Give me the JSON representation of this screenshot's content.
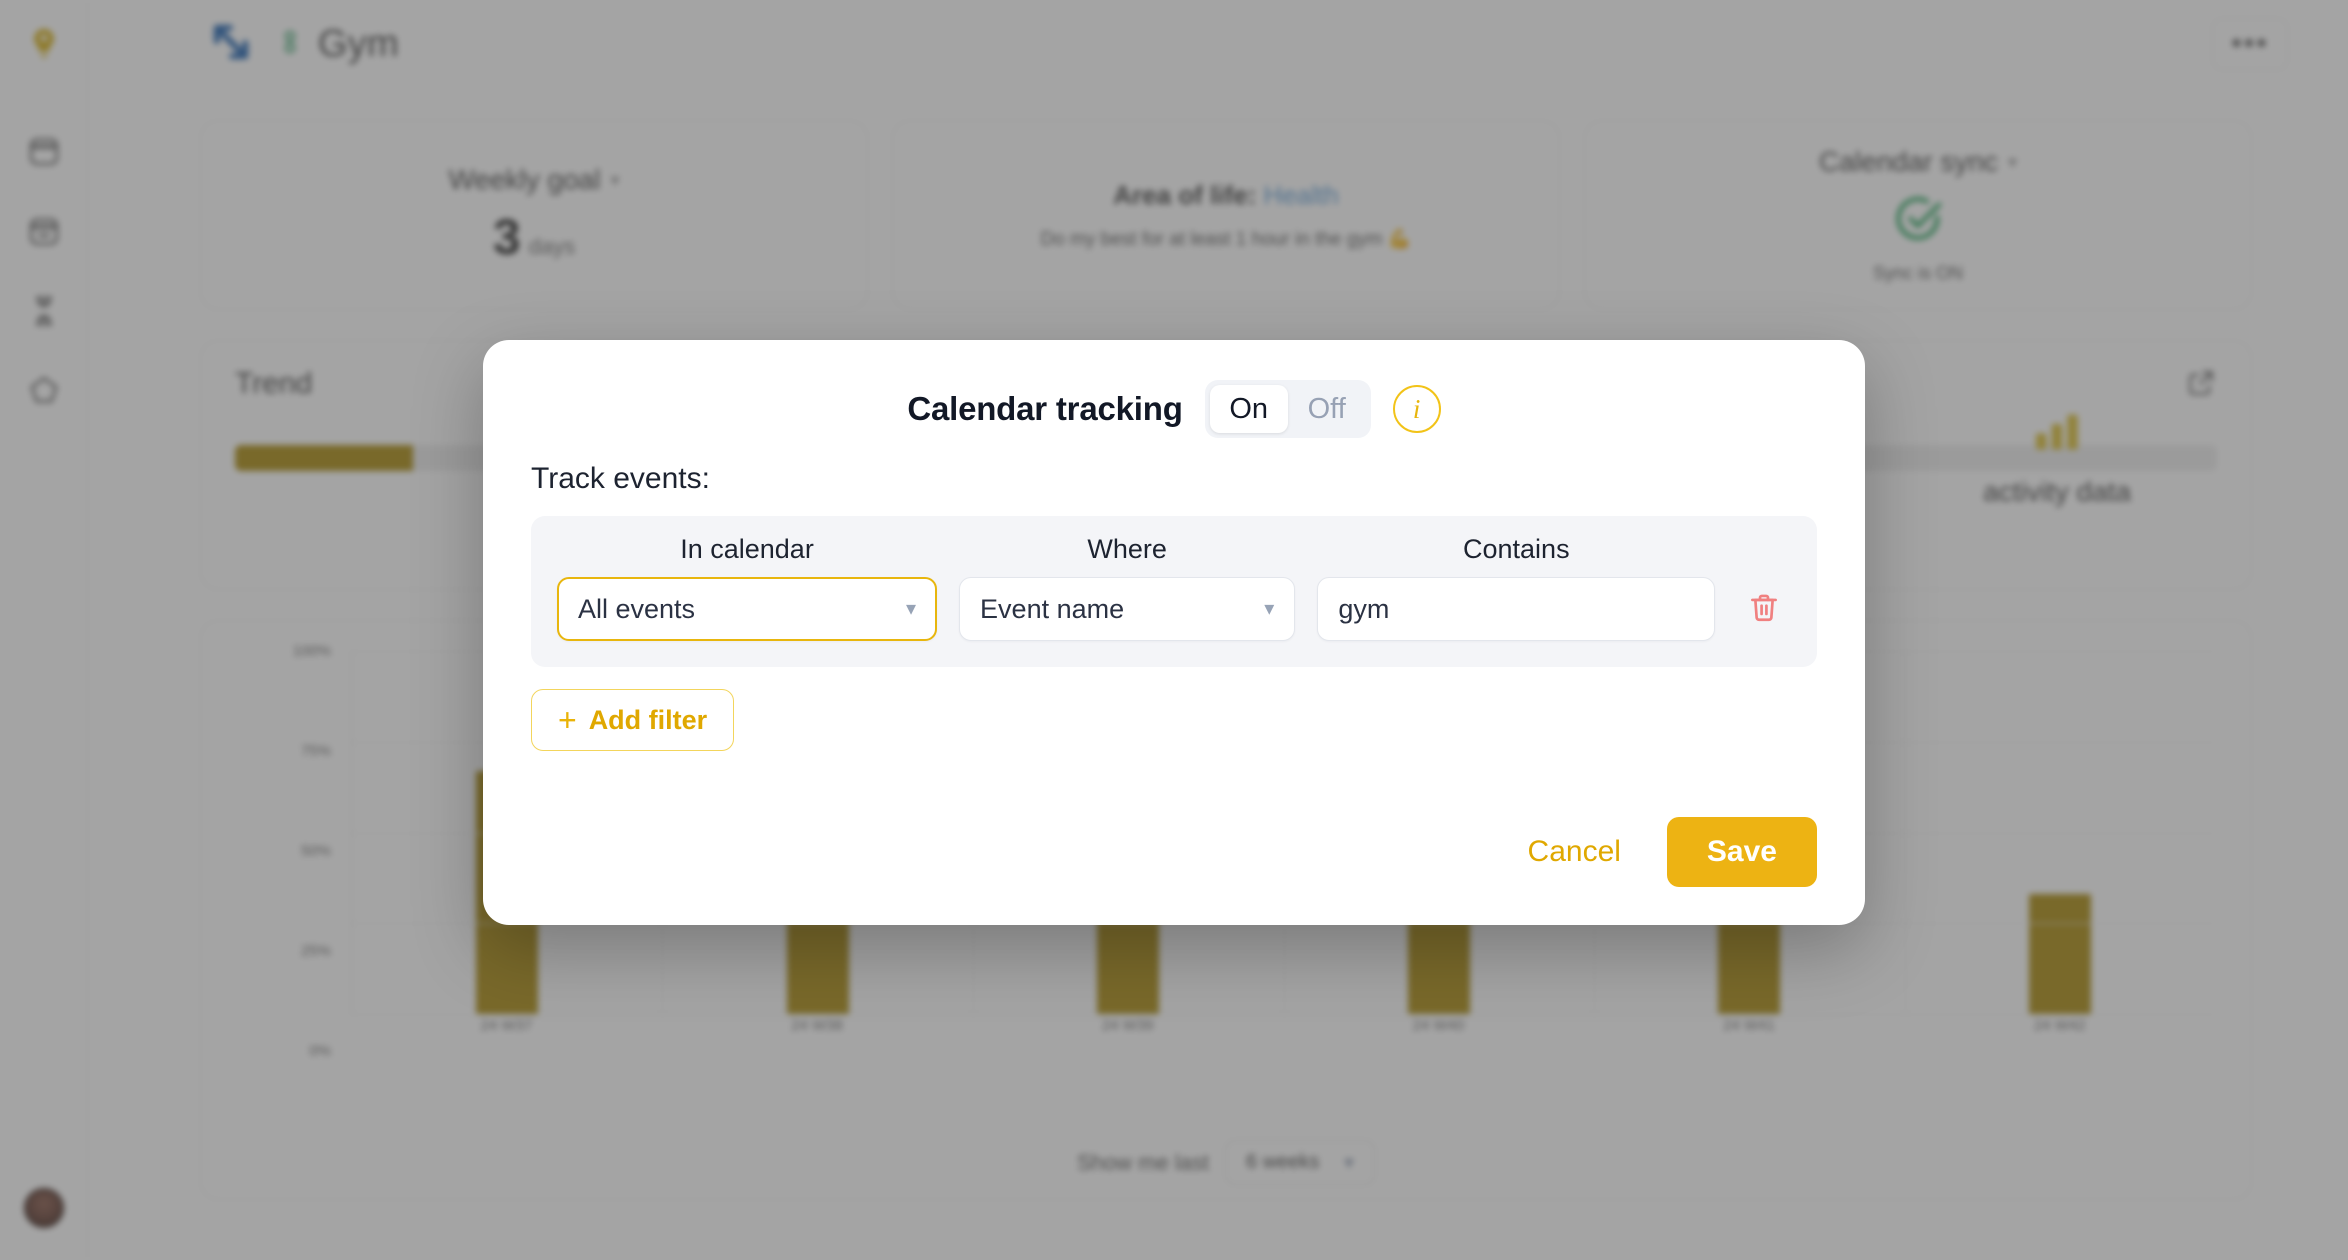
{
  "sidebar": {
    "logo_icon": "lightbulb-icon",
    "items": [
      {
        "icon": "calendar-icon",
        "name": "calendar"
      },
      {
        "icon": "card-list-icon",
        "name": "habits"
      },
      {
        "icon": "hourglass-icon",
        "name": "timer"
      },
      {
        "icon": "pentagon-icon",
        "name": "areas"
      }
    ],
    "avatar_label": ""
  },
  "header": {
    "title": "Gym",
    "resize_icon": "resize-arrows-icon",
    "recycle_icon": "recycle-icon",
    "more_label": "•••"
  },
  "cards": {
    "weekly_goal": {
      "heading": "Weekly goal",
      "value": "3",
      "unit": "days"
    },
    "area_of_life": {
      "label": "Area of life:",
      "value": "Health",
      "description": "Do my best for at least 1 hour in the gym 💪"
    },
    "calendar_sync": {
      "heading": "Calendar sync",
      "status_icon": "check-circle-icon",
      "status": "Sync is ON"
    }
  },
  "trend": {
    "title": "Trend",
    "progress_percent": 9,
    "activity_label": "activity data",
    "activity_icon": "bar-chart-icon",
    "external_icon": "external-link-icon"
  },
  "chart_data": {
    "type": "bar",
    "title": "",
    "xlabel": "",
    "ylabel": "",
    "categories": [
      "24 W37",
      "24 W38",
      "24 W39",
      "24 W40",
      "24 W41",
      "24 W42"
    ],
    "values": [
      67,
      67,
      67,
      67,
      33,
      33
    ],
    "ytick_labels": [
      "100%",
      "75%",
      "50%",
      "25%",
      "0%"
    ],
    "ytick_values": [
      100,
      75,
      50,
      25,
      0
    ],
    "ylim": [
      0,
      100
    ],
    "grid": true,
    "legend": "none",
    "bar_color": "#a8880a"
  },
  "chart_footer": {
    "label": "Show me last",
    "select_value": "6 weeks",
    "chevron": "⌄"
  },
  "modal": {
    "title": "Calendar tracking",
    "toggle": {
      "options": [
        "On",
        "Off"
      ],
      "selected": "On"
    },
    "info_icon_label": "i",
    "subtitle": "Track events:",
    "columns": {
      "in_calendar": "In calendar",
      "where": "Where",
      "contains": "Contains"
    },
    "filter_row": {
      "calendar_value": "All events",
      "where_value": "Event name",
      "contains_value": "gym",
      "contains_placeholder": "",
      "delete_icon": "trash-icon"
    },
    "add_filter_label": "Add filter",
    "add_filter_plus": "+",
    "cancel_label": "Cancel",
    "save_label": "Save"
  },
  "colors": {
    "accent": "#edb313",
    "accent_text": "#e0a800",
    "bar": "#a8880a",
    "delete": "#f08080",
    "link": "#5b9bd5",
    "success": "#23a35a"
  }
}
